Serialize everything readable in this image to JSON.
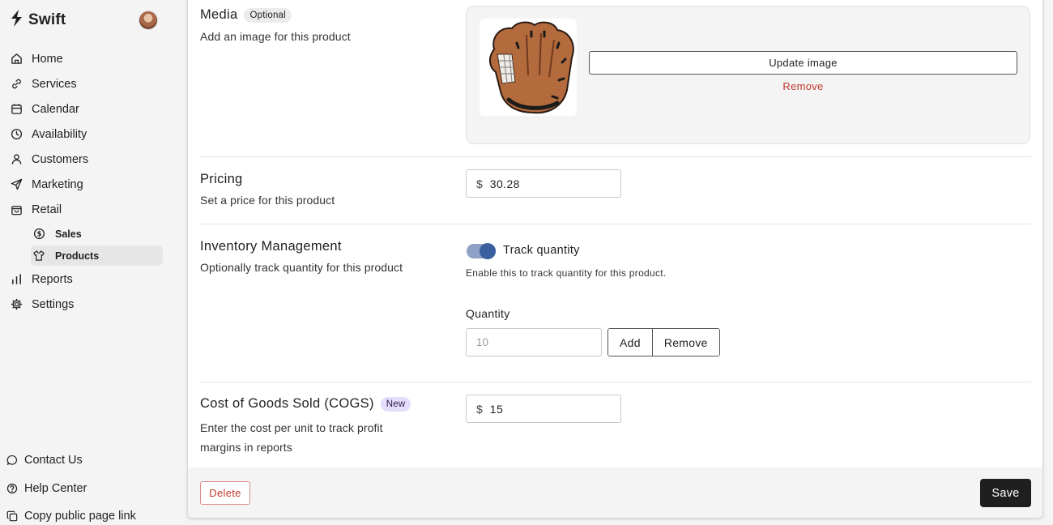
{
  "sidebar": {
    "brand": "Swift",
    "nav": [
      {
        "label": "Home",
        "icon": "home-icon"
      },
      {
        "label": "Services",
        "icon": "link-icon"
      },
      {
        "label": "Calendar",
        "icon": "calendar-icon"
      },
      {
        "label": "Availability",
        "icon": "clock-icon"
      },
      {
        "label": "Customers",
        "icon": "person-icon"
      },
      {
        "label": "Marketing",
        "icon": "send-icon"
      },
      {
        "label": "Retail",
        "icon": "bag-icon"
      }
    ],
    "retail_sub": [
      {
        "label": "Sales",
        "icon": "dollar-circle-icon"
      },
      {
        "label": "Products",
        "icon": "shirt-icon",
        "active": true
      }
    ],
    "nav_after": [
      {
        "label": "Reports",
        "icon": "bar-chart-icon"
      },
      {
        "label": "Settings",
        "icon": "gear-icon"
      }
    ],
    "bottom": [
      {
        "label": "Contact Us",
        "icon": "chat-bubble-icon"
      },
      {
        "label": "Help Center",
        "icon": "help-circle-icon"
      },
      {
        "label": "Copy public page link",
        "icon": "copy-icon"
      }
    ]
  },
  "media": {
    "title": "Media",
    "badge": "Optional",
    "description": "Add an image for this product",
    "update_button": "Update image",
    "remove_link": "Remove"
  },
  "pricing": {
    "title": "Pricing",
    "description": "Set a price for this product",
    "currency": "$",
    "value": "30.28"
  },
  "inventory": {
    "title": "Inventory Management",
    "description": "Optionally track quantity for this product",
    "toggle_label": "Track quantity",
    "toggle_on": true,
    "toggle_help": "Enable this to track quantity for this product.",
    "quantity_label": "Quantity",
    "quantity_placeholder": "10",
    "add_button": "Add",
    "remove_button": "Remove"
  },
  "cogs": {
    "title": "Cost of Goods Sold (COGS)",
    "badge": "New",
    "description_line1": "Enter the cost per unit to track profit",
    "description_line2": "margins in reports",
    "currency": "$",
    "value": "15"
  },
  "footer": {
    "delete_button": "Delete",
    "save_button": "Save"
  },
  "colors": {
    "accent": "#3a5f9e",
    "danger": "#c0392b",
    "primary_button": "#1f1f1f",
    "new_badge": "#e6dcfb"
  }
}
